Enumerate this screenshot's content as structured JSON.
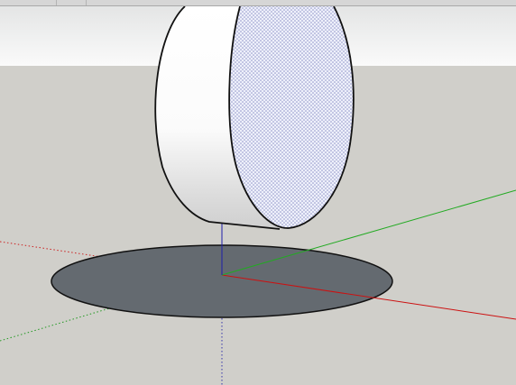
{
  "app": {
    "type": "3D modeling viewport"
  },
  "colors": {
    "sky_top": "#e4e5e5",
    "sky_bottom": "#fafafa",
    "ground": "#d0cfca",
    "axis_red": "#cc1111",
    "axis_green": "#22aa22",
    "axis_blue": "#1e1eaa",
    "shadow": "#646a70",
    "face_pattern": "#b3b5de",
    "edge": "#111111"
  },
  "scene": {
    "objects": [
      {
        "name": "cylinder",
        "kind": "solid",
        "selected": false
      },
      {
        "name": "shadow-ellipse",
        "kind": "ground-shadow"
      }
    ],
    "axes": [
      "red",
      "green",
      "blue"
    ]
  }
}
